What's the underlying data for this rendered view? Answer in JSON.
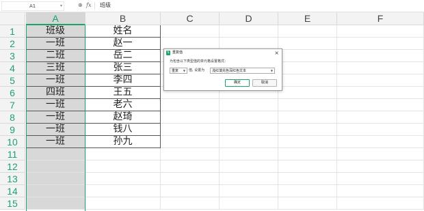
{
  "formula_bar": {
    "name_box": "A1",
    "zoom_icon": "search-icon",
    "fx_label": "fx",
    "content": "班级"
  },
  "sheet": {
    "columns": [
      "A",
      "B",
      "C",
      "D",
      "E",
      "F"
    ],
    "selected_column": "A",
    "row_numbers": [
      "1",
      "2",
      "3",
      "4",
      "5",
      "6",
      "7",
      "8",
      "9",
      "10",
      "11",
      "12",
      "13",
      "14",
      "15"
    ],
    "rows": [
      [
        "班级",
        "姓名"
      ],
      [
        "一班",
        "赵一"
      ],
      [
        "二班",
        "岳二"
      ],
      [
        "三班",
        "张三"
      ],
      [
        "一班",
        "李四"
      ],
      [
        "四班",
        "王五"
      ],
      [
        "一班",
        "老六"
      ],
      [
        "一班",
        "赵琦"
      ],
      [
        "一班",
        "钱八"
      ],
      [
        "一班",
        "孙九"
      ]
    ],
    "accent_color": "#1aa36b"
  },
  "dialog": {
    "title": "重复值",
    "close_label": "×",
    "description": "为包含以下类型值的单元格设置格式：",
    "type_select": "重复",
    "middle_text": "值, 设置为",
    "format_select": "浅红填充色深红色文本",
    "ok_label": "确定",
    "cancel_label": "取消"
  }
}
